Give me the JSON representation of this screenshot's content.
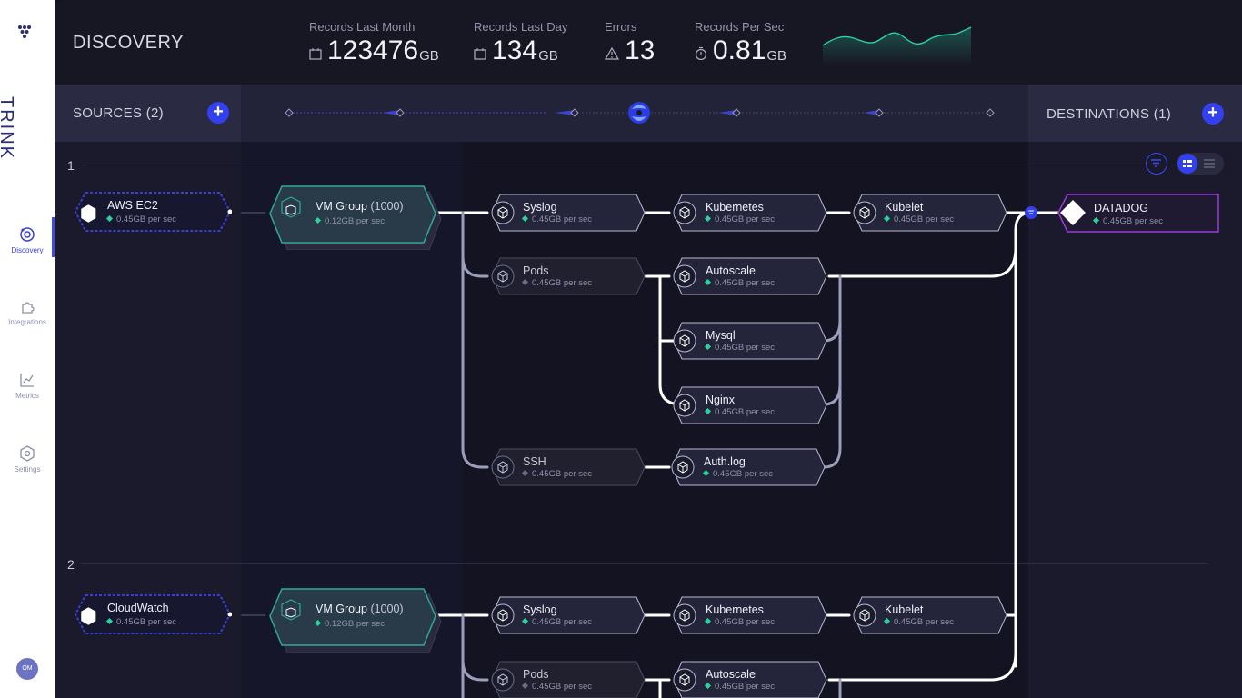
{
  "sidebar": {
    "logo_text": "TRINK",
    "items": [
      {
        "label": "Discovery",
        "icon": "discovery-icon",
        "active": true
      },
      {
        "label": "Integrations",
        "icon": "puzzle-icon",
        "active": false
      },
      {
        "label": "Metrics",
        "icon": "chart-icon",
        "active": false
      },
      {
        "label": "Settings",
        "icon": "gear-icon",
        "active": false
      }
    ],
    "avatar_initials": "OM"
  },
  "header": {
    "title": "DISCOVERY",
    "stats": [
      {
        "label": "Records Last Month",
        "value": "123476",
        "unit": "GB",
        "icon": "calendar-icon"
      },
      {
        "label": "Records Last Day",
        "value": "134",
        "unit": "GB",
        "icon": "calendar-icon"
      },
      {
        "label": "Errors",
        "value": "13",
        "unit": "",
        "icon": "warning-icon"
      },
      {
        "label": "Records Per Sec",
        "value": "0.81",
        "unit": "GB",
        "icon": "stopwatch-icon"
      }
    ]
  },
  "sources": {
    "title": "SOURCES (2)"
  },
  "destinations": {
    "title": "DESTINATIONS (1)"
  },
  "colors": {
    "accent": "#3340f0",
    "status_green": "#29d39b",
    "destination_border": "#9b3bd8"
  },
  "groups": [
    {
      "index": "1",
      "source": {
        "name": "AWS EC2",
        "rate": "0.45GB per sec"
      },
      "vm_group": {
        "name": "VM Group",
        "count": "(1000)",
        "rate": "0.12GB per sec"
      },
      "nodes": {
        "syslog": {
          "name": "Syslog",
          "rate": "0.45GB per sec"
        },
        "kubernetes": {
          "name": "Kubernetes",
          "rate": "0.45GB per sec"
        },
        "kubelet": {
          "name": "Kubelet",
          "rate": "0.45GB per sec"
        },
        "pods": {
          "name": "Pods",
          "rate": "0.45GB per sec"
        },
        "autoscale": {
          "name": "Autoscale",
          "rate": "0.45GB per sec"
        },
        "mysql": {
          "name": "Mysql",
          "rate": "0.45GB per sec"
        },
        "nginx": {
          "name": "Nginx",
          "rate": "0.45GB per sec"
        },
        "ssh": {
          "name": "SSH",
          "rate": "0.45GB per sec"
        },
        "authlog": {
          "name": "Auth.log",
          "rate": "0.45GB per sec"
        }
      },
      "destination": {
        "name": "DATADOG",
        "rate": "0.45GB per sec"
      }
    },
    {
      "index": "2",
      "source": {
        "name": "CloudWatch",
        "rate": "0.45GB per sec"
      },
      "vm_group": {
        "name": "VM Group",
        "count": "(1000)",
        "rate": "0.12GB per sec"
      },
      "nodes": {
        "syslog": {
          "name": "Syslog",
          "rate": "0.45GB per sec"
        },
        "kubernetes": {
          "name": "Kubernetes",
          "rate": "0.45GB per sec"
        },
        "kubelet": {
          "name": "Kubelet",
          "rate": "0.45GB per sec"
        },
        "pods": {
          "name": "Pods",
          "rate": "0.45GB per sec"
        },
        "autoscale": {
          "name": "Autoscale",
          "rate": "0.45GB per sec"
        }
      }
    }
  ]
}
